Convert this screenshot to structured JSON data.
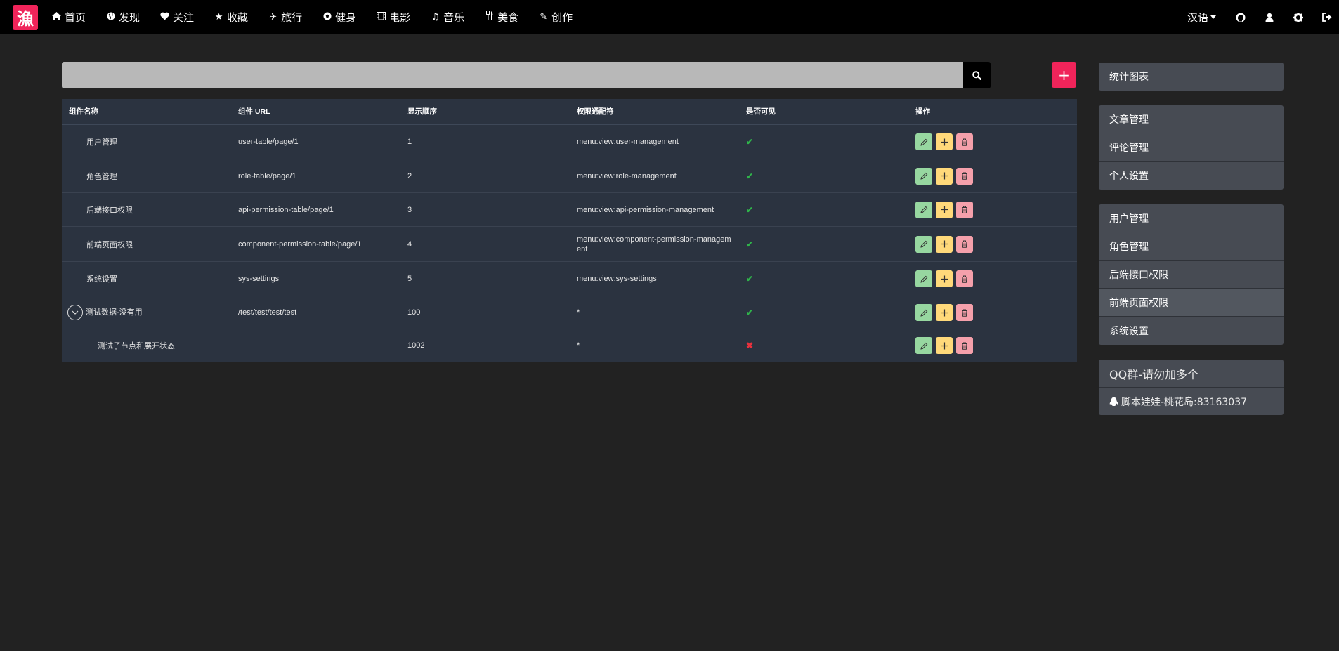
{
  "brand": {
    "logo_char": "漁",
    "color": "#f0245a"
  },
  "nav": {
    "items": [
      {
        "icon": "home-icon",
        "label": "首页"
      },
      {
        "icon": "globe-icon",
        "label": "发现"
      },
      {
        "icon": "heart-icon",
        "label": "关注"
      },
      {
        "icon": "star-icon",
        "label": "收藏"
      },
      {
        "icon": "plane-icon",
        "label": "旅行"
      },
      {
        "icon": "soccer-icon",
        "label": "健身"
      },
      {
        "icon": "film-icon",
        "label": "电影"
      },
      {
        "icon": "music-icon",
        "label": "音乐"
      },
      {
        "icon": "cutlery-icon",
        "label": "美食"
      },
      {
        "icon": "pencil-icon",
        "label": "创作"
      }
    ],
    "language": "汉语",
    "right_icons": [
      "github-icon",
      "user-icon",
      "gear-icon",
      "sign-out-icon"
    ]
  },
  "search": {
    "placeholder": "",
    "value": ""
  },
  "add_button": {
    "label": "+"
  },
  "table": {
    "headers": [
      "组件名称",
      "组件 URL",
      "显示顺序",
      "权限通配符",
      "是否可见",
      "操作"
    ],
    "rows": [
      {
        "name": "用户管理",
        "url": "user-table/page/1",
        "order": "1",
        "permission": "menu:view:user-management",
        "visible": true,
        "level": 1,
        "expandable": false
      },
      {
        "name": "角色管理",
        "url": "role-table/page/1",
        "order": "2",
        "permission": "menu:view:role-management",
        "visible": true,
        "level": 1,
        "expandable": false
      },
      {
        "name": "后端接口权限",
        "url": "api-permission-table/page/1",
        "order": "3",
        "permission": "menu:view:api-permission-management",
        "visible": true,
        "level": 1,
        "expandable": false
      },
      {
        "name": "前端页面权限",
        "url": "component-permission-table/page/1",
        "order": "4",
        "permission": "menu:view:component-permission-management",
        "visible": true,
        "level": 1,
        "expandable": false
      },
      {
        "name": "系统设置",
        "url": "sys-settings",
        "order": "5",
        "permission": "menu:view:sys-settings",
        "visible": true,
        "level": 1,
        "expandable": false
      },
      {
        "name": "测试数据-没有用",
        "url": "/test/test/test/test",
        "order": "100",
        "permission": "*",
        "visible": true,
        "level": 1,
        "expandable": true
      },
      {
        "name": "测试子节点和展开状态",
        "url": "",
        "order": "1002",
        "permission": "*",
        "visible": false,
        "level": 2,
        "expandable": false
      }
    ],
    "check_mark": "✔",
    "cross_mark": "✖"
  },
  "sidebar": {
    "groups": [
      {
        "items": [
          {
            "label": "统计图表"
          }
        ]
      },
      {
        "items": [
          {
            "label": "文章管理"
          },
          {
            "label": "评论管理"
          },
          {
            "label": "个人设置"
          }
        ]
      },
      {
        "items": [
          {
            "label": "用户管理"
          },
          {
            "label": "角色管理"
          },
          {
            "label": "后端接口权限"
          },
          {
            "label": "前端页面权限",
            "active": true
          },
          {
            "label": "系统设置"
          }
        ]
      }
    ],
    "qq": {
      "title": "QQ群-请勿加多个",
      "entry": "脚本娃娃-桃花岛:83163037"
    }
  },
  "colors": {
    "edit": "#97d7a0",
    "add": "#ffd97a",
    "delete": "#f5a0ab",
    "visible": "#2fb34a",
    "hidden": "#e8313d"
  }
}
